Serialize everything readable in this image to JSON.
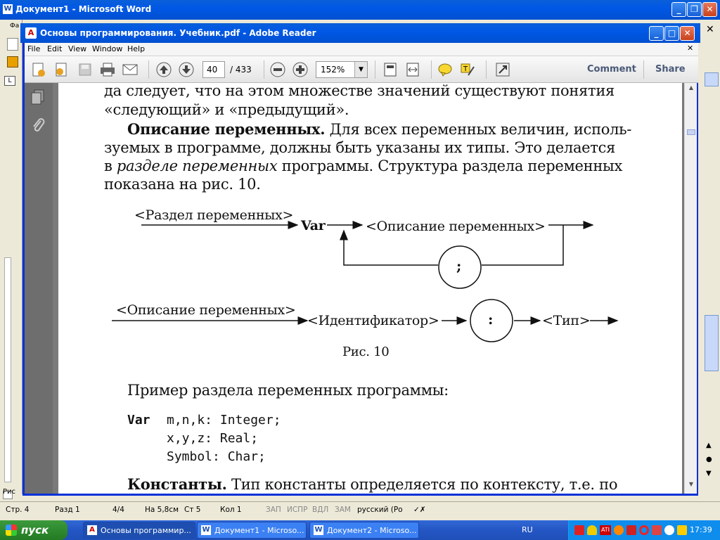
{
  "word": {
    "title": "Документ1 - Microsoft Word",
    "status": {
      "page": "Стр. 4",
      "section": "Разд 1",
      "pages": "4/4",
      "at": "На 5,8см",
      "line": "Ст 5",
      "col": "Кол 1",
      "rec": "ЗАП",
      "trk": "ИСПР",
      "ext": "ВДЛ",
      "ovr": "ЗАМ",
      "lang": "русский (Ро"
    },
    "left_fragments": [
      "Фа",
      "Рис"
    ]
  },
  "reader": {
    "title": "Основы программирования. Учебник.pdf - Adobe Reader",
    "menu": [
      "File",
      "Edit",
      "View",
      "Window",
      "Help"
    ],
    "toolbar": {
      "page_current": "40",
      "page_total": "/ 433",
      "zoom": "152%",
      "comment_label": "Comment",
      "share_label": "Share"
    },
    "page_content": {
      "line1": "да следует, что на этом множестве значений существуют понятия",
      "line2": "«следующий» и «предыдущий».",
      "para_bold": "Описание переменных.",
      "para_rest1": " Для всех переменных величин, исполь-",
      "para_line2": "зуемых в программе, должны быть указаны их типы. Это делается",
      "para_line3_pre": "в ",
      "para_line3_it": "разделе переменных",
      "para_line3_post": " программы. Структура раздела переменных",
      "para_line4": "показана на рис. 10.",
      "diagram": {
        "razdel": "<Раздел переменных>",
        "var_kw": "Var",
        "opisanie1": "<Описание переменных>",
        "semicolon": ";",
        "opisanie2": "<Описание переменных>",
        "identifier": "<Идентификатор>",
        "colon": ":",
        "tip": "<Тип>",
        "caption": "Рис. 10"
      },
      "example_label": "Пример раздела переменных программы:",
      "code": {
        "kw": "Var",
        "line1": "m,n,k: Integer;",
        "line2": "x,y,z: Real;",
        "line3": "Symbol: Char;"
      },
      "konst_bold": "Константы.",
      "konst_rest": " Тип константы определяется по контексту, т.е. по"
    }
  },
  "taskbar": {
    "start_label": "пуск",
    "tasks": [
      "Основы программир...",
      "Документ1 - Microso...",
      "Документ2 - Microso..."
    ],
    "lang": "RU",
    "clock": "17:39"
  }
}
